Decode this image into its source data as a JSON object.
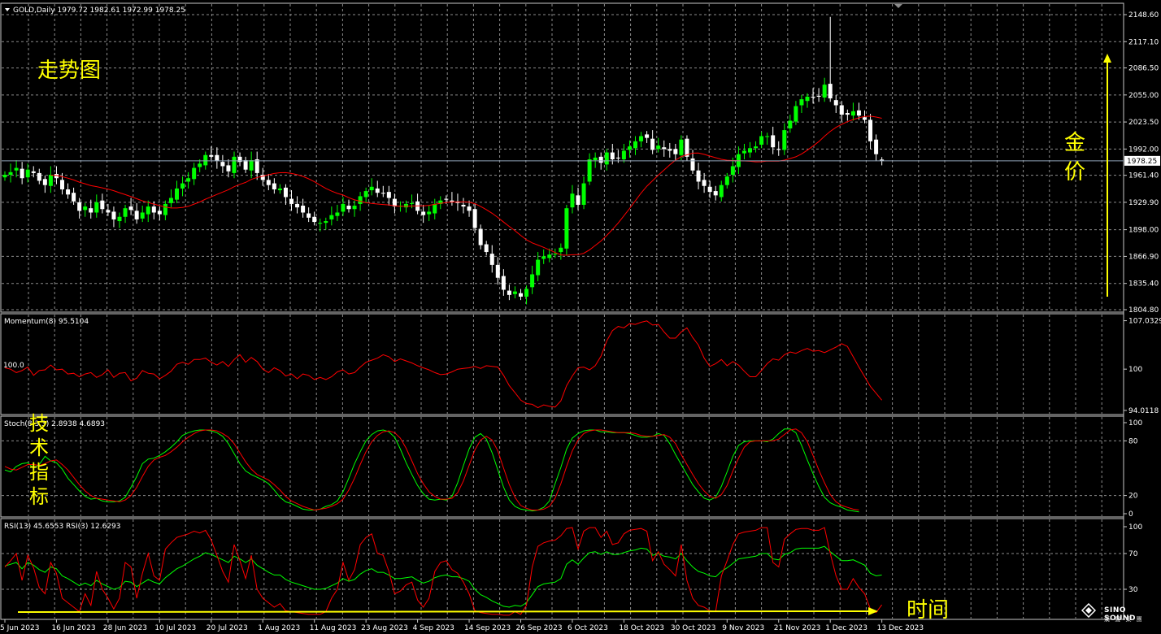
{
  "chart_header": {
    "symbol_line": "GOLD,Daily  1979.72 1982.61 1972.99 1978.25",
    "current_price": "1978.25"
  },
  "annotations": {
    "trend_chart": "走势图",
    "gold_price": [
      "金",
      "价"
    ],
    "technical_indicators": [
      "技",
      "术",
      "指",
      "标"
    ],
    "time": "时间"
  },
  "logo": {
    "name": "SINO SOUND",
    "sub": "漢 聲 集 團",
    "icon": "diamond-logo-icon"
  },
  "colors": {
    "background": "#000000",
    "grid": "#8c8c8c",
    "bull_candle": "#00ff00",
    "bear_candle": "#ffffff",
    "moving_average": "#ff0000",
    "indicator_red": "#ff0000",
    "indicator_green": "#00ff00",
    "annotation": "#ffff00",
    "price_line": "#8fa3b8"
  },
  "chart_data": [
    {
      "type": "candlestick",
      "name": "GOLD,Daily",
      "ylim": [
        1804.8,
        2148.6
      ],
      "y_ticks": [
        "2148.60",
        "2117.10",
        "2086.50",
        "2055.00",
        "2023.50",
        "1992.00",
        "1961.40",
        "1929.90",
        "1898.00",
        "1866.90",
        "1835.40",
        "1804.80"
      ],
      "x_ticks": [
        "5 Jun 2023",
        "16 Jun 2023",
        "28 Jun 2023",
        "10 Jul 2023",
        "20 Jul 2023",
        "1 Aug 2023",
        "11 Aug 2023",
        "23 Aug 2023",
        "4 Sep 2023",
        "14 Sep 2023",
        "26 Sep 2023",
        "6 Oct 2023",
        "18 Oct 2023",
        "30 Oct 2023",
        "9 Nov 2023",
        "21 Nov 2023",
        "1 Dec 2023",
        "13 Dec 2023"
      ],
      "closes": [
        1962,
        1965,
        1970,
        1958,
        1968,
        1964,
        1955,
        1950,
        1962,
        1958,
        1945,
        1939,
        1931,
        1920,
        1925,
        1918,
        1930,
        1922,
        1918,
        1910,
        1913,
        1923,
        1921,
        1910,
        1918,
        1925,
        1918,
        1916,
        1928,
        1935,
        1946,
        1952,
        1958,
        1970,
        1975,
        1985,
        1983,
        1978,
        1972,
        1966,
        1983,
        1977,
        1968,
        1979,
        1964,
        1956,
        1950,
        1945,
        1946,
        1936,
        1928,
        1924,
        1918,
        1912,
        1907,
        1906,
        1908,
        1915,
        1918,
        1928,
        1922,
        1926,
        1937,
        1943,
        1948,
        1941,
        1940,
        1935,
        1925,
        1926,
        1928,
        1929,
        1920,
        1915,
        1919,
        1928,
        1932,
        1933,
        1930,
        1929,
        1925,
        1920,
        1900,
        1880,
        1872,
        1857,
        1842,
        1828,
        1822,
        1826,
        1820,
        1829,
        1846,
        1863,
        1867,
        1869,
        1870,
        1877,
        1923,
        1940,
        1927,
        1952,
        1980,
        1982,
        1976,
        1988,
        1980,
        1981,
        1990,
        1995,
        2001,
        2007,
        2005,
        1991,
        1996,
        1992,
        1990,
        1986,
        2003,
        1983,
        1967,
        1954,
        1949,
        1942,
        1938,
        1950,
        1960,
        1972,
        1986,
        1990,
        1993,
        1995,
        2007,
        2007,
        1994,
        1991,
        2014,
        2025,
        2042,
        2050,
        2053,
        2052,
        2053,
        2067,
        2051,
        2043,
        2032,
        2032,
        2036,
        2031,
        2026,
        2001,
        1986,
        1978
      ],
      "opens_and_extremes": "daily candles, last candle O 1979.72 H 1982.61 L 1972.99 C 1978.25"
    },
    {
      "type": "line",
      "name": "Momentum(8)",
      "value": "95.5104",
      "y_ticks": [
        "107.0329",
        "100",
        "94.0118"
      ],
      "level_label": "100.0",
      "ylim": [
        94.0,
        107.1
      ],
      "values": [
        100.2,
        100.0,
        99.5,
        99.8,
        100.3,
        99.1,
        99.8,
        99.9,
        100.6,
        99.9,
        100.0,
        99.3,
        99.4,
        98.9,
        99.3,
        99.5,
        98.8,
        99.2,
        99.9,
        98.8,
        99.4,
        99.5,
        98.3,
        98.7,
        99.8,
        99.4,
        99.3,
        98.6,
        99.1,
        99.7,
        100.7,
        101.0,
        100.7,
        101.4,
        101.4,
        101.6,
        101.0,
        100.6,
        101.1,
        100.4,
        101.4,
        102.1,
        101.0,
        101.7,
        101.1,
        100.0,
        99.5,
        100.2,
        99.8,
        99.0,
        99.3,
        98.6,
        99.3,
        99.1,
        98.5,
        98.8,
        98.5,
        98.9,
        99.6,
        99.9,
        99.3,
        99.5,
        100.3,
        101.0,
        101.3,
        101.6,
        102.1,
        101.8,
        101.1,
        101.5,
        101.2,
        100.9,
        100.5,
        100.2,
        99.9,
        99.5,
        99.2,
        99.3,
        99.6,
        100.0,
        100.1,
        100.2,
        100.4,
        100.1,
        100.5,
        100.4,
        100.3,
        99.1,
        97.6,
        96.6,
        95.5,
        95.0,
        94.9,
        94.4,
        94.8,
        94.6,
        94.5,
        95.4,
        97.6,
        99.0,
        100.2,
        100.3,
        99.9,
        100.5,
        101.9,
        104.1,
        105.6,
        106.2,
        106.0,
        106.6,
        106.5,
        106.8,
        107.0,
        106.4,
        106.5,
        105.4,
        104.5,
        104.5,
        105.4,
        106.0,
        104.6,
        103.5,
        101.6,
        100.4,
        100.8,
        101.4,
        100.5,
        101.1,
        100.6,
        99.7,
        98.9,
        98.9,
        99.8,
        100.8,
        101.5,
        101.3,
        102.1,
        102.5,
        102.3,
        102.7,
        103.0,
        102.6,
        102.7,
        102.4,
        102.8,
        103.2,
        103.7,
        103.3,
        101.8,
        100.3,
        98.9,
        97.5,
        96.5,
        95.5
      ]
    },
    {
      "type": "line",
      "name": "Stoch(8,3,3)",
      "value": "2.8938 4.6893",
      "y_ticks": [
        "100",
        "80",
        "20",
        "0"
      ],
      "ylim": [
        0,
        100
      ],
      "series": [
        {
          "name": "main",
          "values": [
            48,
            46,
            52,
            55,
            56,
            50,
            54,
            63,
            58,
            56,
            49,
            39,
            32,
            25,
            19,
            16,
            17,
            14,
            13,
            13,
            14,
            18,
            29,
            41,
            55,
            60,
            61,
            64,
            68,
            73,
            79,
            86,
            89,
            91,
            92,
            92,
            91,
            89,
            85,
            77,
            66,
            55,
            47,
            43,
            40,
            37,
            33,
            26,
            18,
            13,
            11,
            8,
            5,
            4,
            4,
            5,
            8,
            10,
            14,
            24,
            39,
            55,
            68,
            80,
            87,
            91,
            92,
            90,
            84,
            71,
            56,
            43,
            31,
            22,
            16,
            15,
            16,
            15,
            19,
            34,
            53,
            71,
            84,
            88,
            82,
            67,
            48,
            29,
            15,
            8,
            5,
            4,
            3,
            4,
            7,
            14,
            33,
            51,
            71,
            83,
            88,
            91,
            92,
            92,
            90,
            90,
            89,
            89,
            89,
            88,
            86,
            84,
            84,
            85,
            88,
            86,
            77,
            65,
            54,
            43,
            32,
            24,
            17,
            15,
            18,
            30,
            46,
            63,
            75,
            79,
            80,
            80,
            80,
            79,
            82,
            88,
            93,
            93,
            89,
            75,
            59,
            44,
            30,
            18,
            12,
            9,
            7,
            4,
            3,
            2
          ]
        },
        {
          "name": "signal",
          "values": [
            52,
            49,
            48,
            51,
            54,
            54,
            53,
            55,
            58,
            59,
            54,
            48,
            40,
            32,
            25,
            20,
            17,
            16,
            15,
            14,
            13,
            15,
            20,
            29,
            41,
            52,
            59,
            62,
            64,
            68,
            73,
            79,
            84,
            88,
            91,
            92,
            92,
            91,
            88,
            84,
            77,
            67,
            57,
            49,
            43,
            40,
            37,
            32,
            26,
            19,
            14,
            11,
            8,
            6,
            4,
            5,
            6,
            8,
            11,
            16,
            26,
            39,
            54,
            68,
            79,
            86,
            90,
            91,
            89,
            83,
            72,
            58,
            44,
            33,
            24,
            19,
            16,
            16,
            17,
            23,
            36,
            53,
            70,
            81,
            85,
            81,
            69,
            50,
            32,
            18,
            9,
            6,
            4,
            4,
            5,
            8,
            17,
            33,
            52,
            69,
            81,
            88,
            91,
            92,
            92,
            91,
            90,
            89,
            89,
            89,
            88,
            86,
            85,
            85,
            86,
            87,
            84,
            77,
            65,
            54,
            43,
            33,
            25,
            19,
            17,
            21,
            31,
            47,
            61,
            73,
            79,
            80,
            80,
            80,
            80,
            82,
            87,
            92,
            93,
            89,
            79,
            64,
            48,
            34,
            21,
            13,
            9,
            7,
            5,
            4
          ]
        }
      ]
    },
    {
      "type": "line",
      "name": "RSI",
      "value": "RSI(13) 45.6553  RSI(3) 12.6293",
      "y_ticks": [
        "100",
        "70",
        "30"
      ],
      "ylim": [
        0,
        100
      ],
      "series": [
        {
          "name": "RSI(13)",
          "values": [
            56,
            58,
            60,
            53,
            60,
            57,
            52,
            49,
            55,
            53,
            45,
            42,
            38,
            34,
            37,
            34,
            40,
            36,
            33,
            30,
            32,
            39,
            38,
            33,
            37,
            41,
            38,
            36,
            43,
            48,
            53,
            56,
            60,
            64,
            67,
            71,
            69,
            66,
            63,
            60,
            67,
            64,
            60,
            64,
            57,
            53,
            49,
            46,
            46,
            41,
            38,
            36,
            34,
            32,
            30,
            30,
            31,
            34,
            37,
            42,
            39,
            41,
            47,
            51,
            53,
            49,
            49,
            46,
            42,
            42,
            43,
            44,
            40,
            37,
            39,
            43,
            45,
            46,
            44,
            44,
            42,
            39,
            30,
            24,
            21,
            17,
            14,
            11,
            10,
            12,
            11,
            15,
            24,
            33,
            36,
            37,
            38,
            42,
            58,
            63,
            58,
            65,
            71,
            72,
            69,
            72,
            69,
            69,
            71,
            73,
            74,
            76,
            75,
            68,
            70,
            67,
            66,
            64,
            70,
            62,
            55,
            50,
            48,
            45,
            44,
            50,
            54,
            59,
            64,
            65,
            66,
            67,
            70,
            70,
            64,
            63,
            69,
            71,
            75,
            76,
            76,
            76,
            76,
            78,
            72,
            67,
            62,
            62,
            63,
            60,
            57,
            48,
            45,
            46
          ]
        },
        {
          "name": "RSI(3)",
          "values": [
            55,
            62,
            70,
            40,
            68,
            54,
            32,
            25,
            60,
            48,
            20,
            15,
            10,
            5,
            25,
            12,
            50,
            30,
            20,
            8,
            20,
            60,
            55,
            20,
            48,
            70,
            45,
            40,
            75,
            82,
            88,
            90,
            92,
            95,
            93,
            96,
            85,
            68,
            50,
            38,
            80,
            62,
            42,
            68,
            30,
            20,
            15,
            10,
            14,
            6,
            5,
            4,
            3,
            2,
            2,
            2,
            5,
            20,
            30,
            60,
            40,
            52,
            80,
            88,
            92,
            70,
            68,
            50,
            25,
            28,
            35,
            38,
            18,
            10,
            20,
            50,
            60,
            62,
            52,
            48,
            38,
            25,
            6,
            4,
            3,
            2,
            2,
            1,
            1,
            5,
            2,
            12,
            55,
            78,
            82,
            84,
            85,
            90,
            98,
            99,
            75,
            95,
            99,
            99,
            88,
            95,
            80,
            82,
            92,
            96,
            97,
            98,
            95,
            62,
            72,
            58,
            52,
            45,
            80,
            40,
            20,
            12,
            10,
            6,
            5,
            45,
            62,
            80,
            92,
            94,
            95,
            96,
            99,
            99,
            60,
            55,
            86,
            92,
            97,
            98,
            98,
            96,
            96,
            99,
            70,
            45,
            30,
            30,
            42,
            32,
            25,
            8,
            4,
            12.6
          ]
        }
      ]
    }
  ]
}
